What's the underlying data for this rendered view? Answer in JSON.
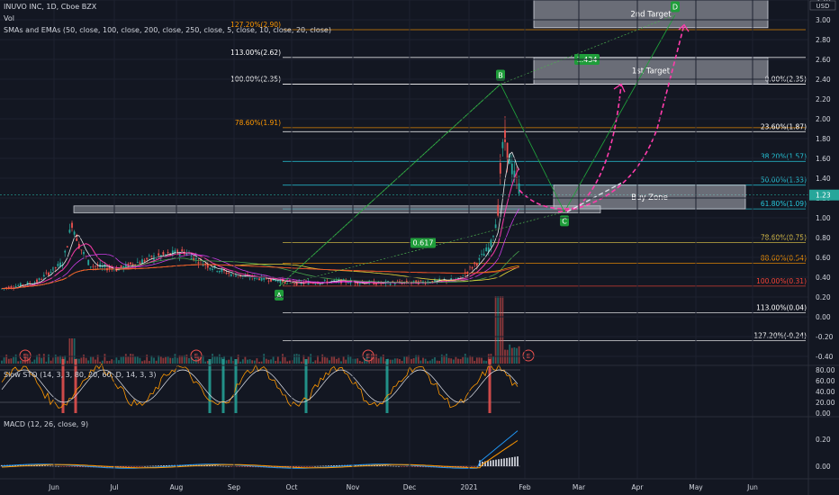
{
  "header": {
    "symbol_line": "INUVO INC, 1D, Cboe BZX",
    "volume_label": "Vol",
    "ma_label": "SMAs and EMAs (50, close, 100, close, 200, close, 250, close, 5, close, 10, close, 20, close)"
  },
  "price_axis": {
    "currency": "USD",
    "ticks": [
      "3.20",
      "3.00",
      "2.80",
      "2.60",
      "2.40",
      "2.20",
      "2.00",
      "1.80",
      "1.60",
      "1.40",
      "1.20",
      "1.00",
      "0.80",
      "0.60",
      "0.40",
      "0.20",
      "0.00",
      "-0.20",
      "-0.40"
    ],
    "tick_values": [
      3.2,
      3.0,
      2.8,
      2.6,
      2.4,
      2.2,
      2.0,
      1.8,
      1.6,
      1.4,
      1.2,
      1.0,
      0.8,
      0.6,
      0.4,
      0.2,
      0.0,
      -0.2,
      -0.4
    ],
    "last_price": "1.23",
    "last_price_value": 1.23
  },
  "time_axis": {
    "labels": [
      "Jun",
      "Jul",
      "Aug",
      "Sep",
      "Oct",
      "Nov",
      "Dec",
      "2021",
      "Feb",
      "Mar",
      "Apr",
      "May",
      "Jun"
    ]
  },
  "fib_left": [
    {
      "label": "127.20%(2.90)",
      "value": 2.9,
      "color": "#ff9800"
    },
    {
      "label": "113.00%(2.62)",
      "value": 2.62,
      "color": "#ffffff"
    },
    {
      "label": "100.00%(2.35)",
      "value": 2.35,
      "color": "#ffffff"
    },
    {
      "label": "78.60%(1.91)",
      "value": 1.91,
      "color": "#ff9800"
    }
  ],
  "fib_right": [
    {
      "label": "0.00%(2.35)",
      "value": 2.35,
      "color": "#ffffff"
    },
    {
      "label": "23.60%(1.87)",
      "value": 1.87,
      "color": "#ffffff"
    },
    {
      "label": "38.20%(1.57)",
      "value": 1.57,
      "color": "#26c6da"
    },
    {
      "label": "50.00%(1.33)",
      "value": 1.33,
      "color": "#26c6da"
    },
    {
      "label": "61.80%(1.09)",
      "value": 1.09,
      "color": "#26c6da"
    },
    {
      "label": "78.60%(0.75)",
      "value": 0.75,
      "color": "#e6c84a"
    },
    {
      "label": "88.60%(0.54)",
      "value": 0.54,
      "color": "#ff9800"
    },
    {
      "label": "100.00%(0.31)",
      "value": 0.31,
      "color": "#f44336"
    },
    {
      "label": "113.00%(0.04)",
      "value": 0.04,
      "color": "#ffffff"
    },
    {
      "label": "127.20%(-0.24)",
      "value": -0.24,
      "color": "#ffffff"
    }
  ],
  "zones": [
    {
      "label": "2nd Target",
      "top": 3.2,
      "bottom": 2.92
    },
    {
      "label": "1st Target",
      "top": 2.62,
      "bottom": 2.35
    },
    {
      "label": "Buy Zone",
      "top": 1.33,
      "bottom": 1.09
    }
  ],
  "pivots": [
    {
      "label": "A",
      "value": 0.31
    },
    {
      "label": "B",
      "value": 2.35
    },
    {
      "label": "C",
      "value": 1.06
    },
    {
      "label": "D",
      "value": 3.05
    }
  ],
  "ratios": [
    "0.617",
    "1.434"
  ],
  "earnings_marker": "E",
  "sto": {
    "label": "Slow STO (14, 3, 3, 80, 20, 60, D, 14, 3, 3)",
    "ticks": [
      "80.00",
      "60.00",
      "40.00",
      "20.00",
      "0.00"
    ],
    "tick_values": [
      80,
      60,
      40,
      20,
      0
    ]
  },
  "macd": {
    "label": "MACD (12, 26, close, 9)",
    "ticks": [
      "0.20",
      "0.00"
    ],
    "tick_values": [
      0.2,
      0.0
    ]
  },
  "colors": {
    "background": "#131722",
    "up": "#26a69a",
    "down": "#ef5350",
    "zone_fill": "#b2b5be",
    "projection": "#ff3cac",
    "projection_alt": "#e0e3eb",
    "pivot": "#1f9d3a",
    "fast_ma": "#ff3cac",
    "slow_ma": "#ffeb3b"
  },
  "chart_data": {
    "type": "line",
    "title": "INUVO INC, 1D, Cboe BZX",
    "series": [
      {
        "name": "close",
        "x": [
          "Jun",
          "Jul",
          "Aug",
          "Sep",
          "Oct",
          "Nov",
          "Dec",
          "2021",
          "Feb"
        ],
        "values": [
          0.3,
          0.82,
          0.45,
          0.62,
          0.36,
          0.33,
          0.37,
          0.44,
          1.23
        ]
      }
    ],
    "ylim": [
      -0.4,
      3.2
    ],
    "legend": "top-left"
  }
}
